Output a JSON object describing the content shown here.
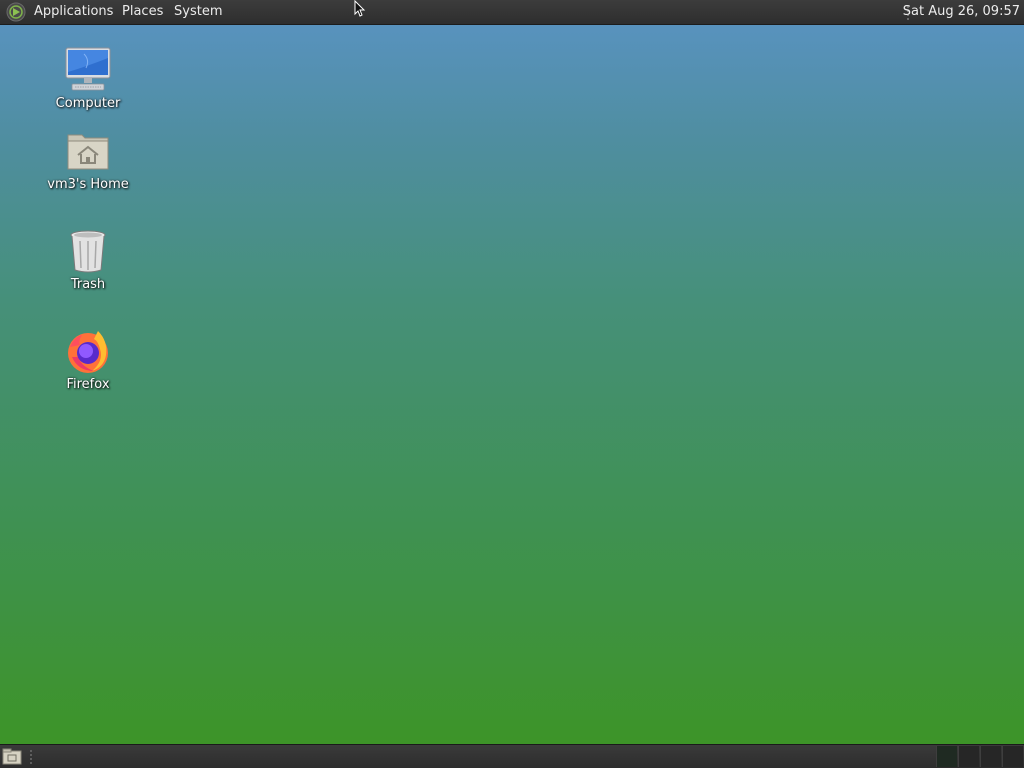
{
  "top_panel": {
    "menus": {
      "applications": "Applications",
      "places": "Places",
      "system": "System"
    },
    "clock": "Sat Aug 26, 09:57"
  },
  "desktop": {
    "icons": [
      {
        "label": "Computer",
        "icon": "computer-icon"
      },
      {
        "label": "vm3's Home",
        "icon": "home-folder-icon"
      },
      {
        "label": "Trash",
        "icon": "trash-icon"
      },
      {
        "label": "Firefox",
        "icon": "firefox-icon"
      }
    ]
  },
  "bottom_panel": {
    "show_desktop_icon": "show-desktop-icon",
    "workspace_count": 4,
    "active_workspace": 1
  },
  "colors": {
    "panel": "#2e2e2e",
    "desktop_top": "#5a93c4",
    "desktop_bottom": "#3d9428",
    "text": "#ececec"
  }
}
